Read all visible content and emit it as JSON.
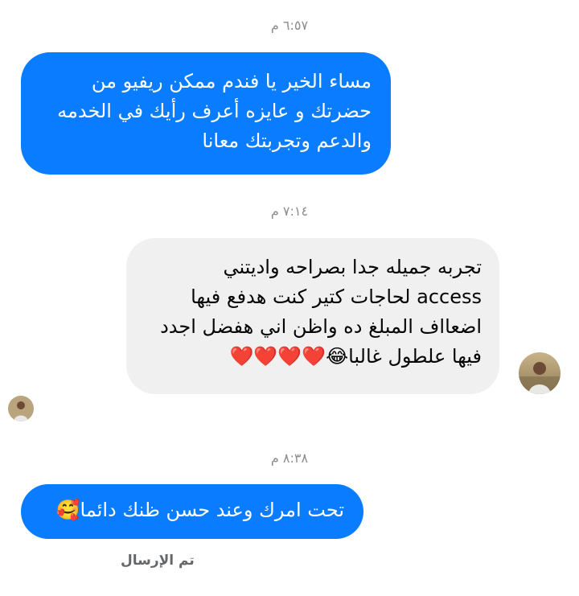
{
  "conversation": {
    "timestamps": [
      "٦:٥٧ م",
      "٧:١٤ م",
      "٨:٣٨ م"
    ],
    "messages": [
      {
        "direction": "sent",
        "text": "مساء الخير يا فندم ممكن ريفيو من\nحضرتك و عايزه أعرف رأيك في الخدمه\nوالدعم وتجربتك معانا"
      },
      {
        "direction": "received",
        "text": "تجربه جميله جدا بصراحه واديتني\naccess  لحاجات كتير كنت هدفع فيها\nاضعااف المبلغ ده واظن اني هفضل اجدد\nفيها علطول غالبا😂❤️❤️❤️❤️"
      },
      {
        "direction": "sent",
        "text": "تحت امرك وعند حسن ظنك دائما🥰"
      }
    ],
    "status": "تم الإرسال"
  },
  "colors": {
    "sent_bubble": "#0a7cff",
    "received_bubble": "#f0f0f0",
    "timestamp_text": "#8a8d91",
    "background": "#ffffff"
  },
  "icons": {
    "large_avatar": "contact-avatar-icon",
    "small_avatar": "read-receipt-avatar-icon"
  }
}
